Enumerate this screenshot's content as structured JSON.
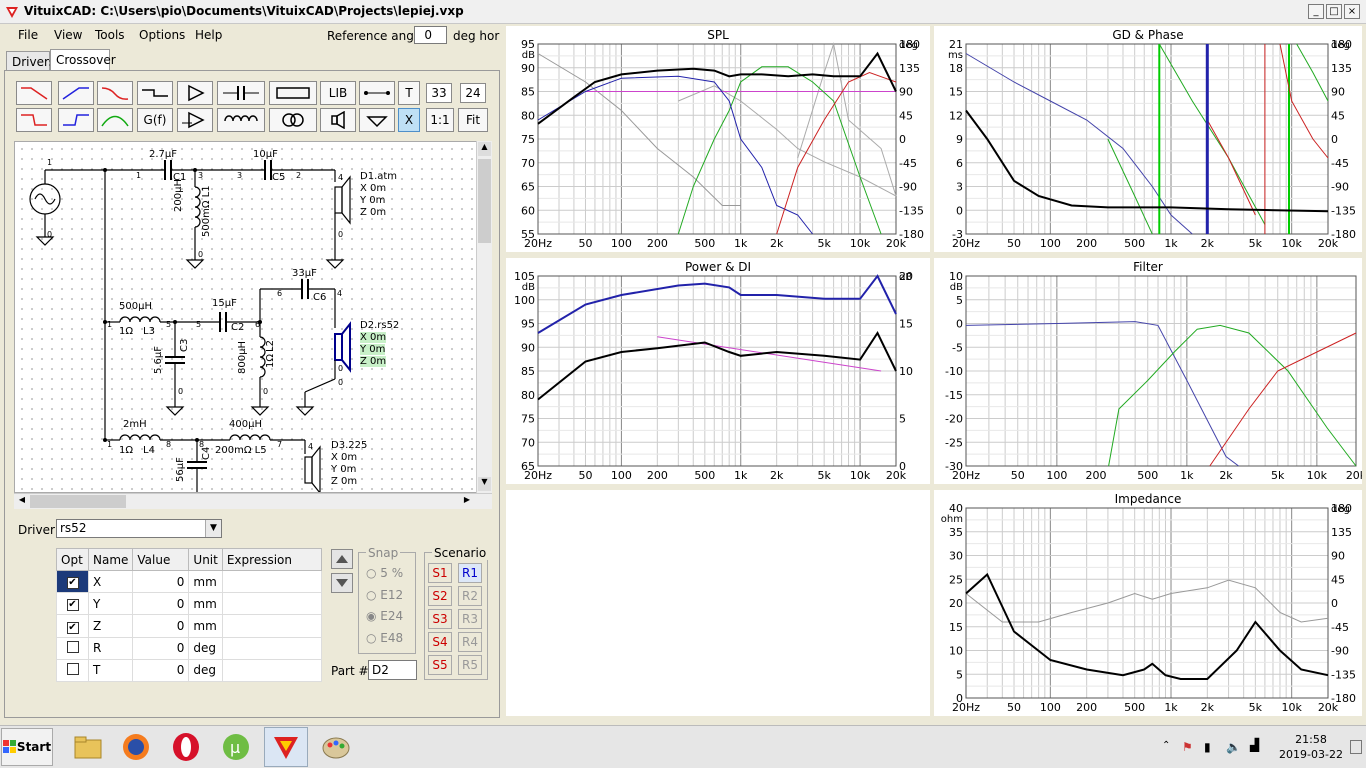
{
  "window": {
    "title": "VituixCAD: C:\\Users\\pio\\Documents\\VituixCAD\\Projects\\lepiej.vxp",
    "minimize": "_",
    "maximize": "□",
    "close": "×"
  },
  "menu": [
    "File",
    "View",
    "Tools",
    "Options",
    "Help"
  ],
  "reference": {
    "label": "Reference angle",
    "value": "0",
    "unit": "deg hor"
  },
  "tabs": [
    "Drivers",
    "Crossover"
  ],
  "toolbar": {
    "lib": "LIB",
    "t": "T",
    "x": "X",
    "ratio": "1:1",
    "fit": "Fit",
    "gf": "G(f)",
    "num1": "33",
    "num2": "24"
  },
  "schematic": {
    "c1_value": "2.7µF",
    "c1_name": "C1",
    "c5_value": "10µF",
    "c5_name": "C5",
    "l1_value": "200µH",
    "l1_res": "500mΩ L1",
    "d1": {
      "name": "D1.atm",
      "x": "X 0m",
      "y": "Y 0m",
      "z": "Z 0m"
    },
    "c6_value": "33µF",
    "c6_name": "C6",
    "l3_value": "500µH",
    "l3_res": "1Ω",
    "l3_name": "L3",
    "c2_value": "15µF",
    "c2_name": "C2",
    "c3_value": "5.6µF",
    "c3_name": "C3",
    "l2_value": "800µH",
    "l2_res": "1Ω",
    "l2_name": "L2",
    "d2": {
      "name": "D2.rs52",
      "x": "X 0m",
      "y": "Y 0m",
      "z": "Z 0m"
    },
    "l4_value": "2mH",
    "l4_res": "1Ω",
    "l4_name": "L4",
    "l5_value": "400µH",
    "l5_res": "200mΩ L5",
    "c4_value": "56µF",
    "c4_name": "C4",
    "d3": {
      "name": "D3.225",
      "x": "X 0m",
      "y": "Y 0m",
      "z": "Z 0m"
    },
    "nodes": [
      "1",
      "1",
      "3",
      "3",
      "2",
      "0",
      "0",
      "0",
      "4",
      "1",
      "5",
      "5",
      "6",
      "6",
      "4",
      "0",
      "0",
      "0",
      "0",
      "1",
      "8",
      "8",
      "7",
      "4"
    ]
  },
  "driver": {
    "label": "Driver",
    "value": "rs52"
  },
  "params": {
    "headers": [
      "Opt",
      "Name",
      "Value",
      "Unit",
      "Expression"
    ],
    "rows": [
      {
        "opt": true,
        "name": "X",
        "value": "0",
        "unit": "mm"
      },
      {
        "opt": true,
        "name": "Y",
        "value": "0",
        "unit": "mm"
      },
      {
        "opt": true,
        "name": "Z",
        "value": "0",
        "unit": "mm"
      },
      {
        "opt": false,
        "name": "R",
        "value": "0",
        "unit": "deg"
      },
      {
        "opt": false,
        "name": "T",
        "value": "0",
        "unit": "deg"
      }
    ]
  },
  "snap": {
    "title": "Snap",
    "options": [
      "5 %",
      "E12",
      "E24",
      "E48"
    ]
  },
  "scenario": {
    "title": "Scenario",
    "s": [
      "S1",
      "S2",
      "S3",
      "S4",
      "S5"
    ],
    "r": [
      "R1",
      "R2",
      "R3",
      "R4",
      "R5"
    ]
  },
  "part": {
    "label": "Part #",
    "value": "D2"
  },
  "charts": {
    "spl": {
      "title": "SPL",
      "yunit": "dB",
      "y2unit": "deg",
      "yticks": [
        "95",
        "90",
        "85",
        "80",
        "75",
        "70",
        "65",
        "60",
        "55"
      ],
      "y2ticks": [
        "180",
        "135",
        "90",
        "45",
        "0",
        "-45",
        "-90",
        "-135",
        "-180"
      ],
      "xticks": [
        "20Hz",
        "50",
        "100",
        "200",
        "500",
        "1k",
        "2k",
        "5k",
        "10k",
        "20k"
      ]
    },
    "gd": {
      "title": "GD & Phase",
      "yunit": "ms",
      "y2unit": "deg",
      "yticks": [
        "21",
        "18",
        "15",
        "12",
        "9",
        "6",
        "3",
        "0",
        "-3"
      ],
      "y2ticks": [
        "180",
        "135",
        "90",
        "45",
        "0",
        "-45",
        "-90",
        "-135",
        "-180"
      ],
      "xticks": [
        "20Hz",
        "50",
        "100",
        "200",
        "500",
        "1k",
        "2k",
        "5k",
        "10k",
        "20k"
      ]
    },
    "power": {
      "title": "Power & DI",
      "yunit": "dB",
      "y2unit": "dB",
      "yticks": [
        "105",
        "100",
        "95",
        "90",
        "85",
        "80",
        "75",
        "70",
        "65"
      ],
      "y2ticks": [
        "20",
        "15",
        "10",
        "5",
        "0"
      ],
      "xticks": [
        "20Hz",
        "50",
        "100",
        "200",
        "500",
        "1k",
        "2k",
        "5k",
        "10k",
        "20k"
      ]
    },
    "filter": {
      "title": "Filter",
      "yunit": "dB",
      "yticks": [
        "10",
        "5",
        "0",
        "-5",
        "-10",
        "-15",
        "-20",
        "-25",
        "-30"
      ],
      "xticks": [
        "20Hz",
        "50",
        "100",
        "200",
        "500",
        "1k",
        "2k",
        "5k",
        "10k",
        "20k"
      ]
    },
    "imp": {
      "title": "Impedance",
      "yunit": "ohm",
      "y2unit": "deg",
      "yticks": [
        "40",
        "35",
        "30",
        "25",
        "20",
        "15",
        "10",
        "5",
        "0"
      ],
      "y2ticks": [
        "180",
        "135",
        "90",
        "45",
        "0",
        "-45",
        "-90",
        "-135",
        "-180"
      ],
      "xticks": [
        "20Hz",
        "50",
        "100",
        "200",
        "500",
        "1k",
        "2k",
        "5k",
        "10k",
        "20k"
      ]
    }
  },
  "taskbar": {
    "start": "Start",
    "time": "21:58",
    "date": "2019-03-22"
  }
}
